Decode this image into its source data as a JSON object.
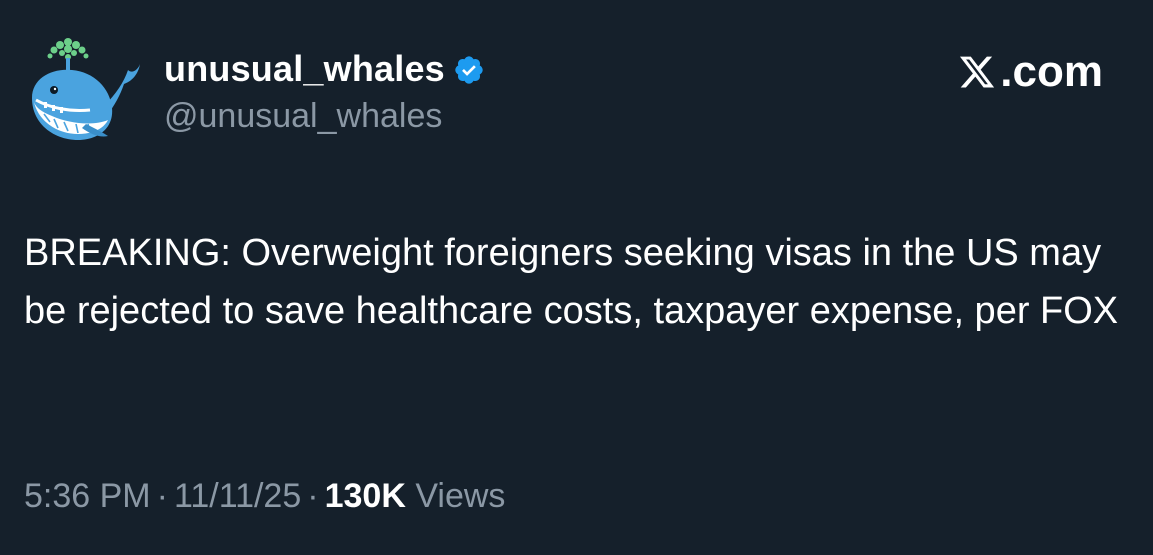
{
  "author": {
    "display_name": "unusual_whales",
    "handle": "@unusual_whales",
    "verified": true,
    "avatar_icon": "whale-icon"
  },
  "brand": {
    "label": ".com",
    "logo_icon": "x-logo-icon"
  },
  "tweet": {
    "text": "BREAKING: Overweight foreigners seeking visas in the US may be rejected to save healthcare costs, taxpayer expense, per FOX"
  },
  "meta": {
    "time": "5:36 PM",
    "separator": "·",
    "date": "11/11/25",
    "views_count": "130K",
    "views_label": "Views"
  },
  "colors": {
    "background": "#15202b",
    "text_primary": "#ffffff",
    "text_secondary": "#8b98a5",
    "verified_badge": "#1d9bf0",
    "whale_body": "#4aa3df",
    "whale_belly": "#ffffff",
    "whale_spout": "#6ccf8a"
  }
}
